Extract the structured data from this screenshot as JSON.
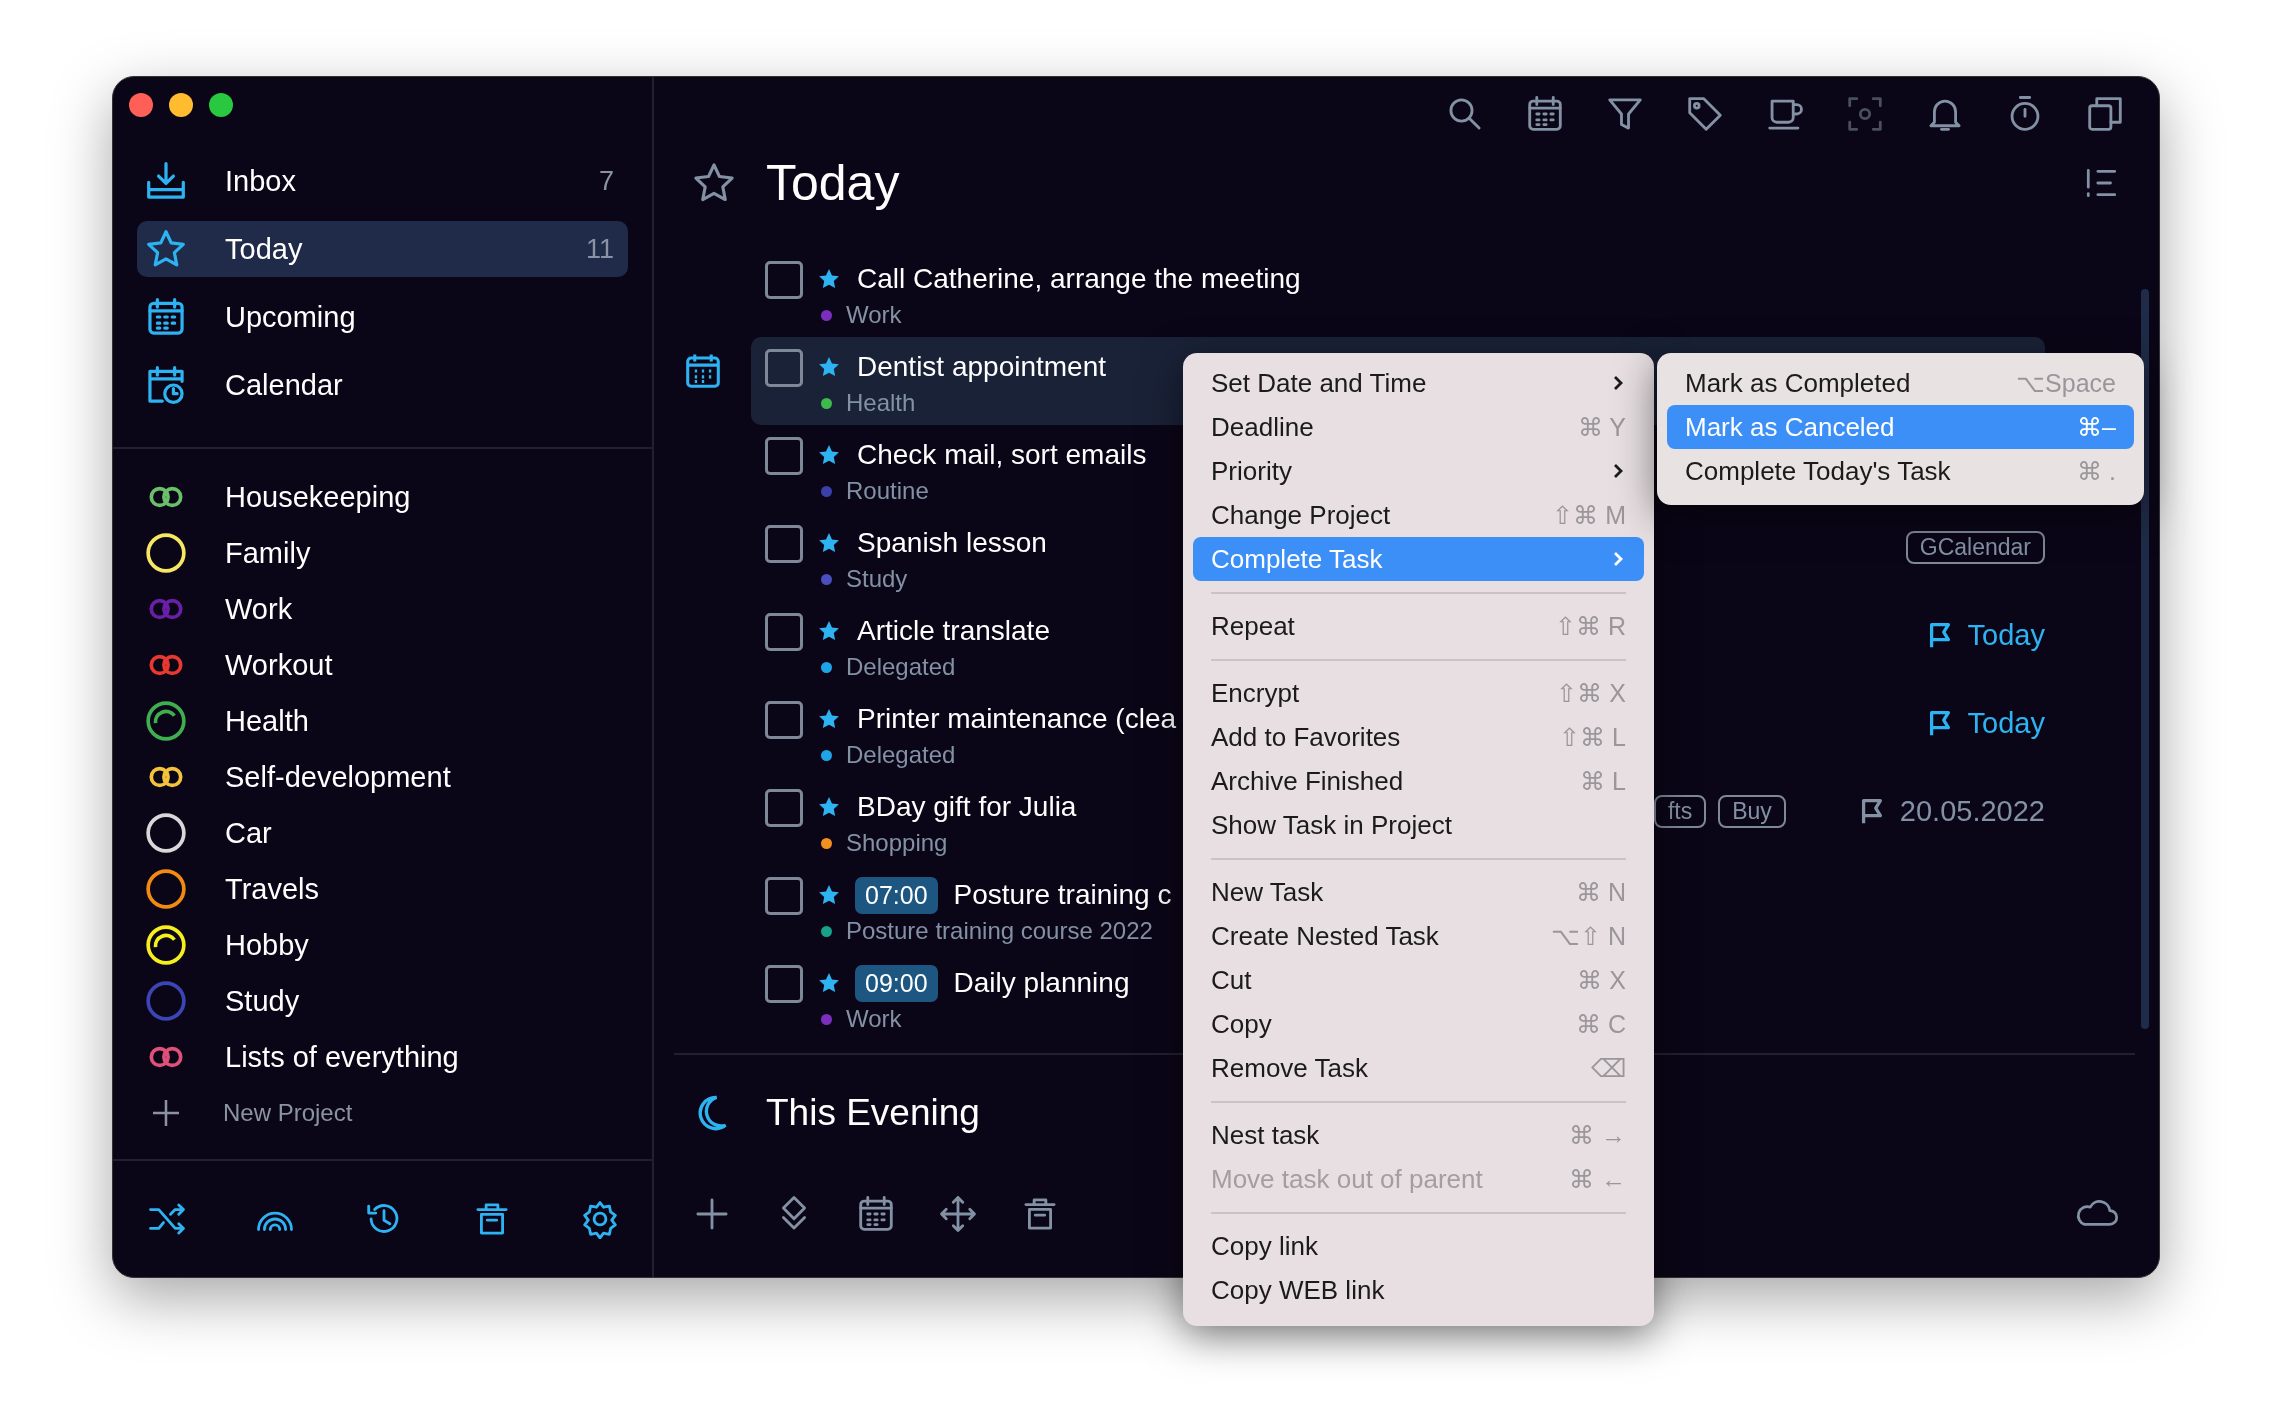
{
  "sidebar": {
    "nav": [
      {
        "kind": "inbox",
        "label": "Inbox",
        "count": "7",
        "selected": false
      },
      {
        "kind": "today",
        "label": "Today",
        "count": "11",
        "selected": true
      },
      {
        "kind": "upcoming",
        "label": "Upcoming",
        "selected": false
      },
      {
        "kind": "calendar",
        "label": "Calendar",
        "selected": false
      }
    ],
    "projects": [
      {
        "kind": "rings",
        "label": "Housekeeping",
        "color": "#6abf69"
      },
      {
        "kind": "ring",
        "label": "Family",
        "color": "#f5e663"
      },
      {
        "kind": "rings",
        "label": "Work",
        "color": "#6a1fa8"
      },
      {
        "kind": "rings",
        "label": "Workout",
        "color": "#e8382f"
      },
      {
        "kind": "ring-arc",
        "label": "Health",
        "color": "#3fae4f"
      },
      {
        "kind": "rings",
        "label": "Self-development",
        "color": "#f3c33b"
      },
      {
        "kind": "ring",
        "label": "Car",
        "color": "#d8d8d8"
      },
      {
        "kind": "ring",
        "label": "Travels",
        "color": "#f08a12"
      },
      {
        "kind": "ring-arc",
        "label": "Hobby",
        "color": "#f6ef1e"
      },
      {
        "kind": "ring",
        "label": "Study",
        "color": "#3b45b5"
      },
      {
        "kind": "rings",
        "label": "Lists of everything",
        "color": "#e0517a"
      }
    ],
    "new_project": "New Project"
  },
  "header": {
    "title": "Today"
  },
  "tasks": [
    {
      "title": "Call Catherine, arrange the meeting",
      "project": "Work",
      "color": "#7b2fbf",
      "checked": false,
      "selected": false
    },
    {
      "title": "Dentist appointment",
      "project": "Health",
      "color": "#3dbb4a",
      "checked": false,
      "selected": true
    },
    {
      "title": "Check mail, sort emails",
      "project": "Routine",
      "color": "#3b3fa8",
      "checked": false,
      "selected": false
    },
    {
      "title": "Spanish lesson",
      "project": "Study",
      "color": "#4a4fc0",
      "checked": false,
      "selected": false,
      "tags": [
        "GCalendar"
      ]
    },
    {
      "title": "Article translate",
      "project": "Delegated",
      "color": "#20a4e8",
      "checked": false,
      "selected": false,
      "due": {
        "text": "Today",
        "highlighted": true
      }
    },
    {
      "title": "Printer maintenance (clea",
      "project": "Delegated",
      "color": "#20a4e8",
      "checked": false,
      "selected": false,
      "due": {
        "text": "Today",
        "highlighted": true
      }
    },
    {
      "title": "BDay gift for Julia",
      "project": "Shopping",
      "color": "#f0901e",
      "checked": false,
      "selected": false,
      "tags": [
        "fts",
        "Buy"
      ],
      "due": {
        "text": "20.05.2022",
        "highlighted": false
      }
    },
    {
      "title": "Posture training c",
      "time": "07:00",
      "project": "Posture training course 2022",
      "color": "#17a08a",
      "checked": false,
      "selected": false
    },
    {
      "title": "Daily planning",
      "time": "09:00",
      "project": "Work",
      "color": "#7b2fbf",
      "checked": false,
      "selected": false
    }
  ],
  "evening": {
    "title": "This Evening"
  },
  "context_menu": {
    "items": [
      {
        "kind": "item",
        "label": "Set Date and Time",
        "submenu": true,
        "selected": false,
        "disabled": false
      },
      {
        "kind": "item",
        "label": "Deadline",
        "shortcut": "⌘ Y",
        "selected": false,
        "disabled": false
      },
      {
        "kind": "item",
        "label": "Priority",
        "submenu": true,
        "selected": false,
        "disabled": false
      },
      {
        "kind": "item",
        "label": "Change Project",
        "shortcut": "⇧⌘ M",
        "selected": false,
        "disabled": false
      },
      {
        "kind": "item",
        "label": "Complete Task",
        "submenu": true,
        "selected": true,
        "disabled": false
      },
      {
        "kind": "separator"
      },
      {
        "kind": "item",
        "label": "Repeat",
        "shortcut": "⇧⌘ R",
        "selected": false,
        "disabled": false
      },
      {
        "kind": "separator"
      },
      {
        "kind": "item",
        "label": "Encrypt",
        "shortcut": "⇧⌘ X",
        "selected": false,
        "disabled": false
      },
      {
        "kind": "item",
        "label": "Add to Favorites",
        "shortcut": "⇧⌘ L",
        "selected": false,
        "disabled": false
      },
      {
        "kind": "item",
        "label": "Archive Finished",
        "shortcut": "⌘ L",
        "selected": false,
        "disabled": false
      },
      {
        "kind": "item",
        "label": "Show Task in Project",
        "selected": false,
        "disabled": false
      },
      {
        "kind": "separator"
      },
      {
        "kind": "item",
        "label": "New Task",
        "shortcut": "⌘ N",
        "selected": false,
        "disabled": false
      },
      {
        "kind": "item",
        "label": "Create Nested Task",
        "shortcut": "⌥⇧ N",
        "selected": false,
        "disabled": false
      },
      {
        "kind": "item",
        "label": "Cut",
        "shortcut": "⌘ X",
        "selected": false,
        "disabled": false
      },
      {
        "kind": "item",
        "label": "Copy",
        "shortcut": "⌘ C",
        "selected": false,
        "disabled": false
      },
      {
        "kind": "item",
        "label": "Remove Task",
        "shortcut": "⌫",
        "selected": false,
        "disabled": false
      },
      {
        "kind": "separator"
      },
      {
        "kind": "item",
        "label": "Nest task",
        "shortcut": "⌘ →",
        "selected": false,
        "disabled": false
      },
      {
        "kind": "item",
        "label": "Move task out of parent",
        "shortcut": "⌘ ←",
        "selected": false,
        "disabled": true
      },
      {
        "kind": "separator"
      },
      {
        "kind": "item",
        "label": "Copy link",
        "selected": false,
        "disabled": false
      },
      {
        "kind": "item",
        "label": "Copy WEB link",
        "selected": false,
        "disabled": false
      }
    ]
  },
  "submenu": {
    "items": [
      {
        "label": "Mark as Completed",
        "shortcut": "⌥Space",
        "selected": false
      },
      {
        "label": "Mark as Canceled",
        "shortcut": "⌘–",
        "selected": true
      },
      {
        "label": "Complete Today's Task",
        "shortcut": "⌘ .",
        "selected": false
      }
    ]
  }
}
